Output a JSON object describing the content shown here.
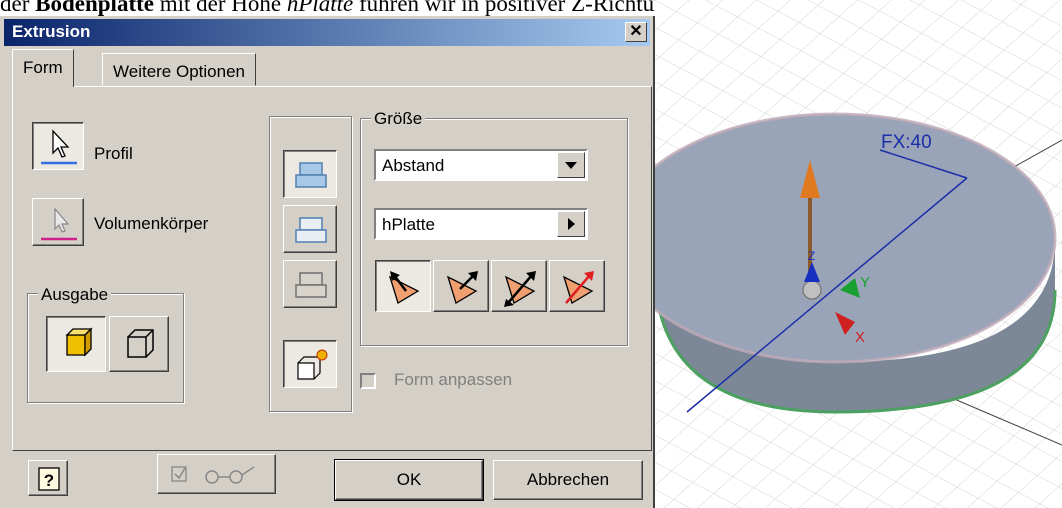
{
  "document": {
    "before": "der ",
    "bold": "Bodenplatte",
    "middle": " mit der Höhe ",
    "italic": "hPlatte",
    "after": " führen wir in positiver Z-Richtung durch."
  },
  "dialog": {
    "title": "Extrusion",
    "close_label": "✕",
    "tabs": [
      {
        "label": "Form",
        "active": true
      },
      {
        "label": "Weitere Optionen",
        "active": false
      }
    ],
    "profil_label": "Profil",
    "volumen_label": "Volumenkörper",
    "ausgabe_legend": "Ausgabe",
    "groesse_legend": "Größe",
    "extent_type": "Abstand",
    "distance_value": "hPlatte",
    "form_anpassen_label": "Form anpassen",
    "ok_label": "OK",
    "cancel_label": "Abbrechen"
  },
  "viewport": {
    "dimension_label": "FX:40",
    "axis_x": "X",
    "axis_y": "Y",
    "axis_z": "Z"
  },
  "colors": {
    "title_start": "#0a246a",
    "title_end": "#a6caf0",
    "dialog_bg": "#d4d0c8",
    "disk_top": "#9aa4b8",
    "disk_side": "#7c8898",
    "dimension_blue": "#1a2ea8"
  }
}
